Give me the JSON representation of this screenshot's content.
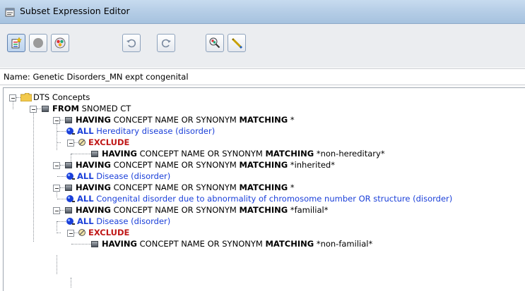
{
  "window": {
    "title": "Subset Expression Editor"
  },
  "toolbar": {
    "buttons": [
      {
        "icon": "new-document-icon"
      },
      {
        "icon": "record-circle-icon"
      },
      {
        "icon": "concept-palette-icon"
      },
      {
        "icon": "undo-icon"
      },
      {
        "icon": "redo-icon"
      },
      {
        "icon": "search-concept-icon"
      },
      {
        "icon": "pencil-icon"
      }
    ]
  },
  "name_row": {
    "label": "Name: Genetic Disorders_MN expt congenital"
  },
  "tree": {
    "root": "DTS Concepts",
    "from_kw": "FROM",
    "from_val": "SNOMED CT",
    "having_kw": "HAVING",
    "matching_kw": "MATCHING",
    "all_kw": "ALL",
    "exclude_kw": "EXCLUDE",
    "cond_phrase": "CONCEPT NAME OR SYNONYM",
    "n1_pattern": "*",
    "n1_all": "Hereditary disease (disorder)",
    "n1_ex_pattern": "*non-hereditary*",
    "n2_pattern": "*inherited*",
    "n2_all": "Disease (disorder)",
    "n3_pattern": "*",
    "n3_all": "Congenital disorder due to abnormality of chromosome number OR structure (disorder)",
    "n4_pattern": "*familial*",
    "n4_all": "Disease (disorder)",
    "n4_ex_pattern": "*non-familial*"
  },
  "colors": {
    "keyword_blue": "#1a3fd9",
    "exclude_red": "#c01818"
  }
}
